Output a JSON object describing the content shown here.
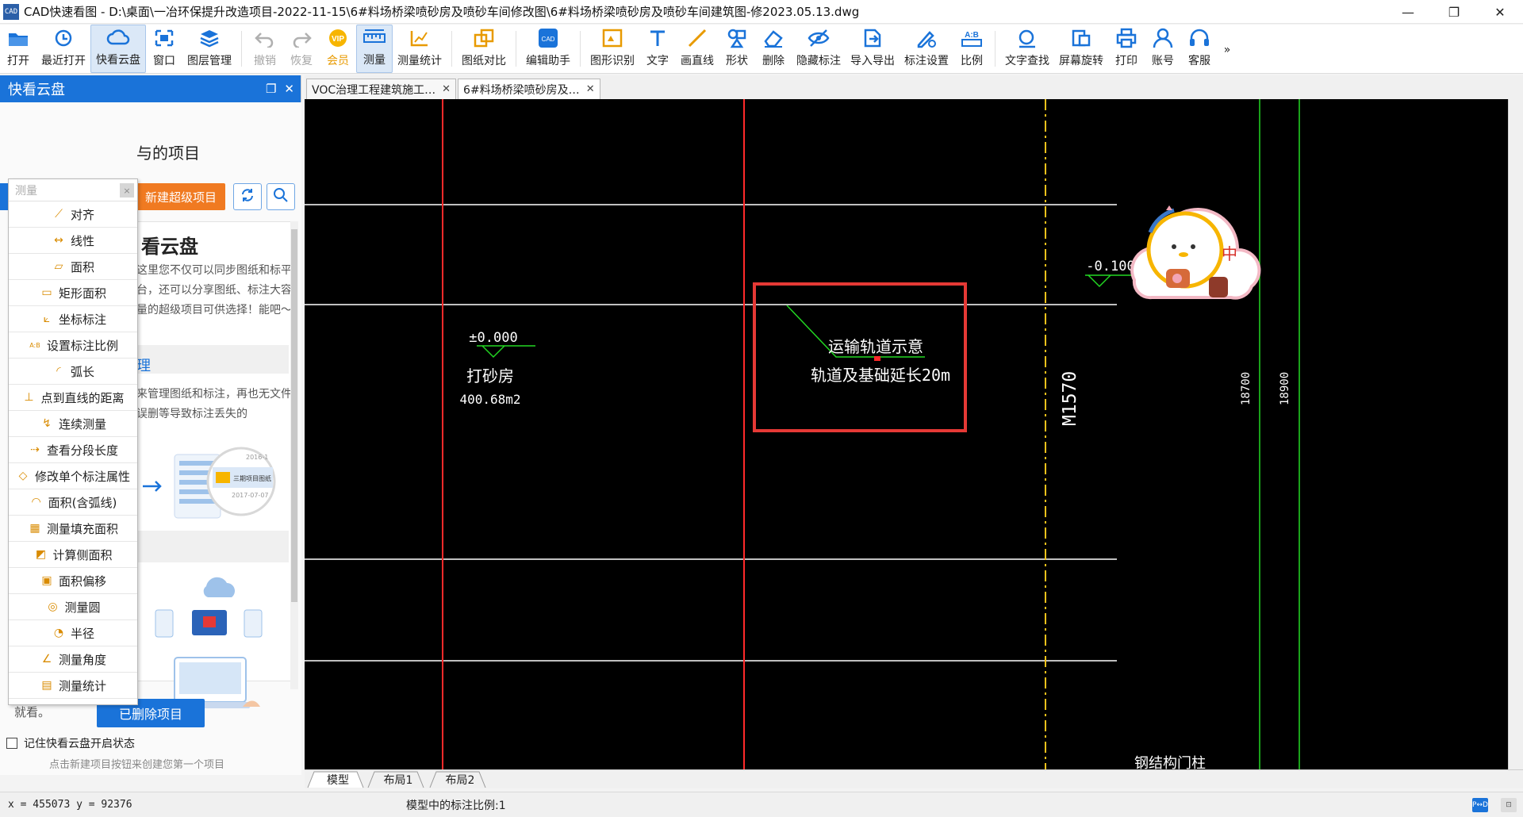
{
  "window": {
    "title": "CAD快速看图 - D:\\桌面\\一冶环保提升改造项目-2022-11-15\\6#料场桥梁喷砂房及喷砂车间修改图\\6#料场桥梁喷砂房及喷砂车间建筑图-修2023.05.13.dwg",
    "app_icon_text": "CAD",
    "controls": [
      "—",
      "❐",
      "✕"
    ]
  },
  "toolbar": {
    "items": [
      {
        "label": "打开",
        "icon": "folder-icon"
      },
      {
        "label": "最近打开",
        "icon": "history-icon"
      },
      {
        "label": "快看云盘",
        "icon": "cloud-icon"
      },
      {
        "label": "窗口",
        "icon": "window-icon"
      },
      {
        "label": "图层管理",
        "icon": "layers-icon"
      },
      {
        "label": "撤销",
        "icon": "undo-icon"
      },
      {
        "label": "恢复",
        "icon": "redo-icon"
      },
      {
        "label": "会员",
        "icon": "vip-icon",
        "icon_text": "VIP"
      },
      {
        "label": "测量",
        "icon": "ruler-icon"
      },
      {
        "label": "测量统计",
        "icon": "measure-stats-icon"
      },
      {
        "label": "图纸对比",
        "icon": "compare-icon"
      },
      {
        "label": "编辑助手",
        "icon": "edit-helper-icon"
      },
      {
        "label": "图形识别",
        "icon": "shape-recognition-icon"
      },
      {
        "label": "文字",
        "icon": "text-icon"
      },
      {
        "label": "画直线",
        "icon": "line-icon"
      },
      {
        "label": "形状",
        "icon": "shape-icon"
      },
      {
        "label": "删除",
        "icon": "eraser-icon"
      },
      {
        "label": "隐藏标注",
        "icon": "hide-annotation-icon"
      },
      {
        "label": "导入导出",
        "icon": "import-export-icon"
      },
      {
        "label": "标注设置",
        "icon": "annotation-settings-icon"
      },
      {
        "label": "比例",
        "icon": "scale-icon",
        "icon_text": "A:B"
      },
      {
        "label": "文字查找",
        "icon": "text-search-icon"
      },
      {
        "label": "屏幕旋转",
        "icon": "rotate-screen-icon"
      },
      {
        "label": "打印",
        "icon": "printer-icon"
      },
      {
        "label": "账号",
        "icon": "account-icon"
      },
      {
        "label": "客服",
        "icon": "headset-icon"
      }
    ],
    "more": "»"
  },
  "left_panel": {
    "title": "快看云盘",
    "header_buttons": [
      "❐",
      "✕"
    ],
    "projects_title": "与的项目",
    "new_super_project": "新建超级项目",
    "cloud_title": "看云盘",
    "cloud_desc": "这里您不仅可以同步图纸和标平台，还可以分享图纸、标注大容量的超级项目可供选择！能吧～",
    "section_title": "理",
    "section_desc": "来管理图纸和标注，再也无文件误删等导致标注丢失的",
    "illus_dates": [
      "2016-1",
      "2017-07-07"
    ],
    "illus_label": "三期项目图纸",
    "bottom_desc": "机／笔记本／手机／平板，各个平台图纸标注共享，随时随地，想看就看。",
    "deleted_button": "已删除项目",
    "remember_label": "记住快看云盘开启状态",
    "hint": "点击新建项目按钮来创建您第一个项目"
  },
  "measure_menu": {
    "placeholder": "测量",
    "clear": "×",
    "items": [
      {
        "label": "对齐",
        "icon": "align-measure-icon"
      },
      {
        "label": "线性",
        "icon": "linear-measure-icon"
      },
      {
        "label": "面积",
        "icon": "area-icon"
      },
      {
        "label": "矩形面积",
        "icon": "rect-area-icon"
      },
      {
        "label": "坐标标注",
        "icon": "coordinate-icon"
      },
      {
        "label": "设置标注比例",
        "icon": "set-scale-icon"
      },
      {
        "label": "弧长",
        "icon": "arc-length-icon"
      },
      {
        "label": "点到直线的距离",
        "icon": "point-line-distance-icon"
      },
      {
        "label": "连续测量",
        "icon": "continuous-measure-icon"
      },
      {
        "label": "查看分段长度",
        "icon": "segment-length-icon"
      },
      {
        "label": "修改单个标注属性",
        "icon": "edit-annotation-icon"
      },
      {
        "label": "面积(含弧线)",
        "icon": "arc-area-icon"
      },
      {
        "label": "测量填充面积",
        "icon": "fill-area-icon"
      },
      {
        "label": "计算侧面积",
        "icon": "side-area-icon"
      },
      {
        "label": "面积偏移",
        "icon": "area-offset-icon"
      },
      {
        "label": "测量圆",
        "icon": "circle-measure-icon"
      },
      {
        "label": "半径",
        "icon": "radius-icon"
      },
      {
        "label": "测量角度",
        "icon": "angle-icon"
      },
      {
        "label": "测量统计",
        "icon": "stats-icon"
      }
    ]
  },
  "doc_tabs": [
    {
      "label": "VOC治理工程建筑施工…",
      "active": false
    },
    {
      "label": "6#料场桥梁喷砂房及…",
      "active": true
    }
  ],
  "drawing": {
    "level_top": "±0.000",
    "room_name": "打砂房",
    "room_area": "400.68m2",
    "level_right": "-0.100",
    "annotation_line1": "运输轨道示意",
    "annotation_line2": "轨道及基础延长20m",
    "door_label": "M1570",
    "dim_1": "18700",
    "dim_2": "18900",
    "bottom_label": "钢结构门柱",
    "sticker_char": "中",
    "highlight_color": "#e53935"
  },
  "layout_tabs": [
    "模型",
    "布局1",
    "布局2"
  ],
  "status": {
    "coords": "x = 455073  y = 92376",
    "scale": "模型中的标注比例:1",
    "right_icons": [
      "P↔D",
      "⊡"
    ]
  }
}
